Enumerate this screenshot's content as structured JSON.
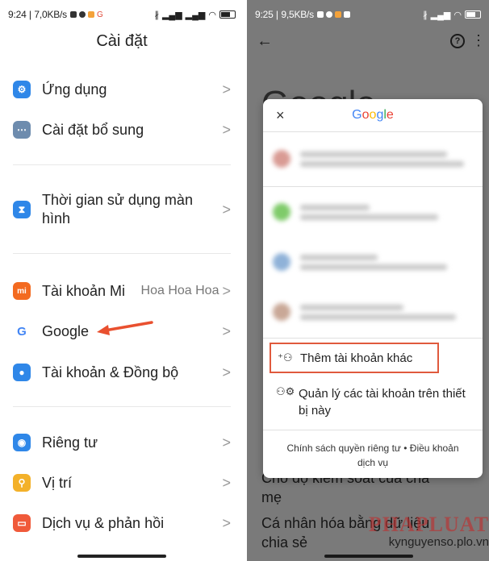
{
  "left": {
    "status": {
      "time": "9:24",
      "speed": "7,0KB/s",
      "signal": "ẞ.ııl.ııl"
    },
    "title": "Cài đặt",
    "items": [
      {
        "label": "Ứng dụng",
        "icon": "apps-icon",
        "color": "#2f87e8"
      },
      {
        "label": "Cài đặt bổ sung",
        "icon": "more-settings-icon",
        "color": "#6e8cae"
      },
      {
        "label": "Thời gian sử dụng màn hình",
        "icon": "hourglass-icon",
        "color": "#2f87e8"
      },
      {
        "label": "Tài khoản Mi",
        "value": "Hoa Hoa Hoa",
        "icon": "mi-logo-icon",
        "color": "#f36a20"
      },
      {
        "label": "Google",
        "icon": "google-g-icon",
        "color": "#ffffff"
      },
      {
        "label": "Tài khoản & Đồng bộ",
        "icon": "account-icon",
        "color": "#2f87e8"
      },
      {
        "label": "Riêng tư",
        "icon": "eye-icon",
        "color": "#2f87e8"
      },
      {
        "label": "Vị trí",
        "icon": "location-icon",
        "color": "#f3b12a"
      },
      {
        "label": "Dịch vụ & phản hồi",
        "icon": "feedback-icon",
        "color": "#f05a3a"
      }
    ],
    "chevron": ">"
  },
  "right": {
    "status": {
      "time": "9:25",
      "speed": "9,5KB/s"
    },
    "bg_title": "Google",
    "bg_text_1": "Cho độ kiểm soát của cha",
    "bg_text_2": "mẹ",
    "bg_text_3": "Cá nhân hóa bằng dữ liệu",
    "bg_text_4": "chia sẻ",
    "dialog": {
      "close": "×",
      "title_parts": [
        "G",
        "o",
        "o",
        "g",
        "l",
        "e"
      ],
      "add_account": "Thêm tài khoản khác",
      "manage_accounts": "Quản lý các tài khoản trên thiết bị này",
      "footer_1": "Chính sách quyền riêng tư • Điều khoản",
      "footer_2": "dịch vụ"
    },
    "watermark_logo": "PHAPLUAT",
    "watermark_site": "kynguyenso.plo.vn"
  },
  "colors": {
    "highlight_border": "#e05a3d",
    "arrow": "#e9502f"
  }
}
